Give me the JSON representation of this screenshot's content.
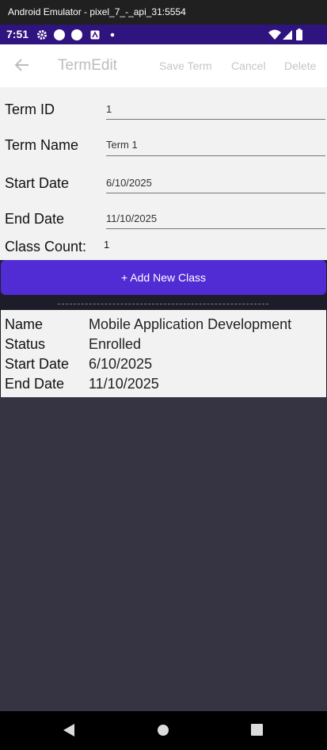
{
  "emulator": {
    "title": "Android Emulator - pixel_7_-_api_31:5554"
  },
  "status_bar": {
    "time": "7:51"
  },
  "toolbar": {
    "title": "TermEdit",
    "save_label": "Save Term",
    "cancel_label": "Cancel",
    "delete_label": "Delete"
  },
  "form": {
    "term_id": {
      "label": "Term ID",
      "value": "1"
    },
    "term_name": {
      "label": "Term Name",
      "value": "Term 1"
    },
    "start_date": {
      "label": "Start Date",
      "value": "6/10/2025"
    },
    "end_date": {
      "label": "End Date",
      "value": "11/10/2025"
    },
    "class_count": {
      "label": "Class Count:",
      "value": "1"
    }
  },
  "add_class_button": {
    "label": "+ Add New Class"
  },
  "class_card": {
    "name": {
      "label": "Name",
      "value": "Mobile Application Development"
    },
    "status": {
      "label": "Status",
      "value": "Enrolled"
    },
    "start_date": {
      "label": "Start Date",
      "value": "6/10/2025"
    },
    "end_date": {
      "label": "End Date",
      "value": "11/10/2025"
    }
  },
  "colors": {
    "status_bar": "#2f137f",
    "accent": "#512bd4",
    "content_background": "#363443"
  }
}
